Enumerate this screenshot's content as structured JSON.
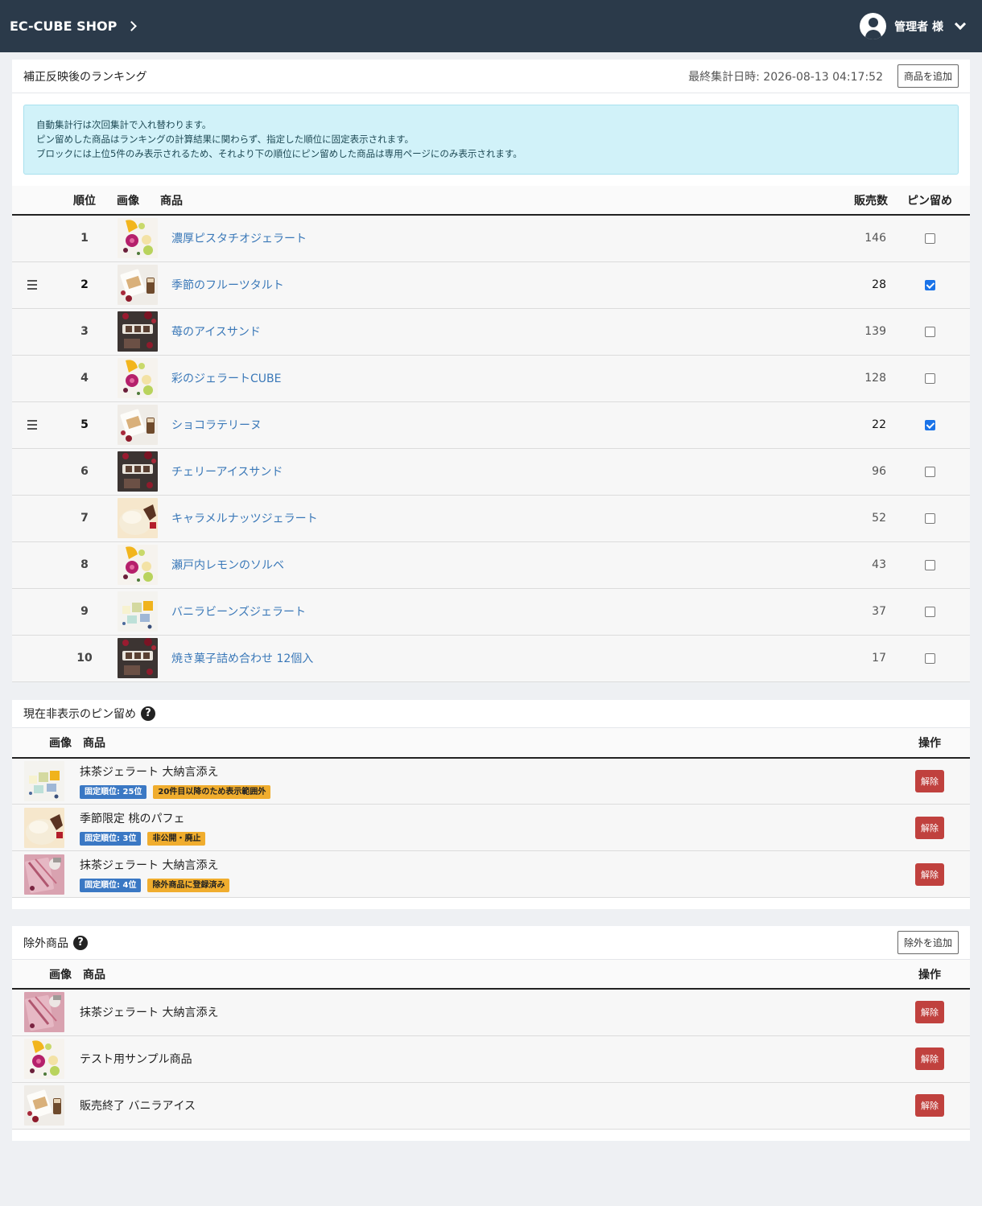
{
  "header": {
    "brand": "EC-CUBE SHOP",
    "user": "管理者 様"
  },
  "ranking": {
    "title": "補正反映後のランキング",
    "last_aggregated": "最終集計日時: 2026-08-13 04:17:52",
    "add_button": "商品を追加",
    "notice": [
      "自動集計行は次回集計で入れ替わります。",
      "ピン留めした商品はランキングの計算結果に関わらず、指定した順位に固定表示されます。",
      "ブロックには上位5件のみ表示されるため、それより下の順位にピン留めした商品は専用ページにのみ表示されます。"
    ],
    "columns": {
      "rank": "順位",
      "image": "画像",
      "product": "商品",
      "sales": "販売数",
      "pin": "ピン留め"
    },
    "rows": [
      {
        "rank": "1",
        "name": "濃厚ピスタチオジェラート",
        "sales": "146",
        "pinned": false,
        "img": "fruit"
      },
      {
        "rank": "2",
        "name": "季節のフルーツタルト",
        "sales": "28",
        "pinned": true,
        "img": "tart"
      },
      {
        "rank": "3",
        "name": "苺のアイスサンド",
        "sales": "139",
        "pinned": false,
        "img": "sand"
      },
      {
        "rank": "4",
        "name": "彩のジェラートCUBE",
        "sales": "128",
        "pinned": false,
        "img": "fruit"
      },
      {
        "rank": "5",
        "name": "ショコラテリーヌ",
        "sales": "22",
        "pinned": true,
        "img": "tart"
      },
      {
        "rank": "6",
        "name": "チェリーアイスサンド",
        "sales": "96",
        "pinned": false,
        "img": "sand"
      },
      {
        "rank": "7",
        "name": "キャラメルナッツジェラート",
        "sales": "52",
        "pinned": false,
        "img": "cream"
      },
      {
        "rank": "8",
        "name": "瀬戸内レモンのソルベ",
        "sales": "43",
        "pinned": false,
        "img": "fruit"
      },
      {
        "rank": "9",
        "name": "バニラビーンズジェラート",
        "sales": "37",
        "pinned": false,
        "img": "cubes"
      },
      {
        "rank": "10",
        "name": "焼き菓子詰め合わせ 12個入",
        "sales": "17",
        "pinned": false,
        "img": "sand"
      }
    ]
  },
  "hidden_pins": {
    "title": "現在非表示のピン留め",
    "help": "?",
    "columns": {
      "image": "画像",
      "product": "商品",
      "action": "操作"
    },
    "rows": [
      {
        "name": "抹茶ジェラート 大納言添え",
        "badge1": "固定順位: 25位",
        "badge2": "20件目以降のため表示範囲外",
        "action": "解除",
        "img": "cubes"
      },
      {
        "name": "季節限定 桃のパフェ",
        "badge1": "固定順位: 3位",
        "badge2": "非公開・廃止",
        "action": "解除",
        "img": "cream"
      },
      {
        "name": "抹茶ジェラート 大納言添え",
        "badge1": "固定順位: 4位",
        "badge2": "除外商品に登録済み",
        "action": "解除",
        "img": "berry"
      }
    ]
  },
  "excluded": {
    "title": "除外商品",
    "help": "?",
    "add_button": "除外を追加",
    "columns": {
      "image": "画像",
      "product": "商品",
      "action": "操作"
    },
    "rows": [
      {
        "name": "抹茶ジェラート 大納言添え",
        "action": "解除",
        "img": "berry"
      },
      {
        "name": "テスト用サンプル商品",
        "action": "解除",
        "img": "fruit"
      },
      {
        "name": "販売終了 バニラアイス",
        "action": "解除",
        "img": "tart"
      }
    ]
  }
}
